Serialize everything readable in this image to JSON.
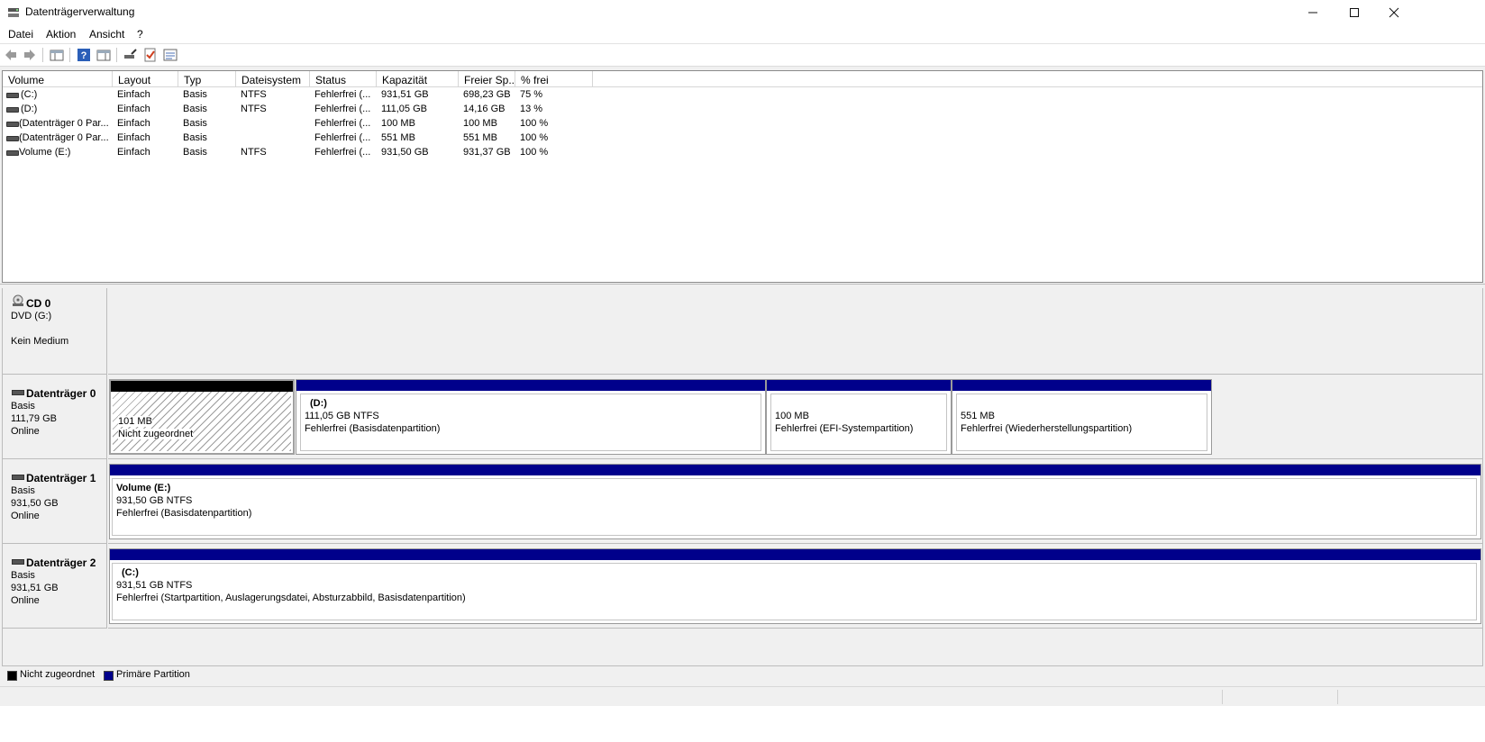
{
  "window": {
    "title": "Datenträgerverwaltung",
    "controls": [
      "minimize",
      "maximize",
      "close"
    ]
  },
  "menu": [
    "Datei",
    "Aktion",
    "Ansicht",
    "?"
  ],
  "toolbar": {
    "icons": [
      "back-arrow-icon",
      "forward-arrow-icon",
      "console-tree-icon",
      "help-icon",
      "action-pane-icon",
      "connect-disk-icon",
      "check-disk-icon",
      "properties-icon"
    ]
  },
  "volume_list": {
    "columns": [
      "Volume",
      "Layout",
      "Typ",
      "Dateisystem",
      "Status",
      "Kapazität",
      "Freier Sp...",
      "% frei"
    ],
    "rows": [
      [
        "(C:)",
        "Einfach",
        "Basis",
        "NTFS",
        "Fehlerfrei (...",
        "931,51 GB",
        "698,23 GB",
        "75 %"
      ],
      [
        "(D:)",
        "Einfach",
        "Basis",
        "NTFS",
        "Fehlerfrei (...",
        "111,05 GB",
        "14,16 GB",
        "13 %"
      ],
      [
        "(Datenträger 0 Par...",
        "Einfach",
        "Basis",
        "",
        "Fehlerfrei (...",
        "100 MB",
        "100 MB",
        "100 %"
      ],
      [
        "(Datenträger 0 Par...",
        "Einfach",
        "Basis",
        "",
        "Fehlerfrei (...",
        "551 MB",
        "551 MB",
        "100 %"
      ],
      [
        "Volume (E:)",
        "Einfach",
        "Basis",
        "NTFS",
        "Fehlerfrei (...",
        "931,50 GB",
        "931,37 GB",
        "100 %"
      ]
    ]
  },
  "disks": {
    "cd0": {
      "name": "CD 0",
      "line1": "DVD (G:)",
      "line2": "Kein Medium"
    },
    "disk0": {
      "name": "Datenträger 0",
      "type": "Basis",
      "size": "111,79 GB",
      "state": "Online",
      "partitions": [
        {
          "title": "",
          "size": "101 MB",
          "status": "Nicht zugeordnet"
        },
        {
          "title": "(D:)",
          "size": "111,05 GB NTFS",
          "status": "Fehlerfrei (Basisdatenpartition)"
        },
        {
          "title": "",
          "size": "100 MB",
          "status": "Fehlerfrei (EFI-Systempartition)"
        },
        {
          "title": "",
          "size": "551 MB",
          "status": "Fehlerfrei (Wiederherstellungspartition)"
        }
      ]
    },
    "disk1": {
      "name": "Datenträger 1",
      "type": "Basis",
      "size": "931,50 GB",
      "state": "Online",
      "partition": {
        "title": "Volume  (E:)",
        "size": "931,50 GB NTFS",
        "status": "Fehlerfrei (Basisdatenpartition)"
      }
    },
    "disk2": {
      "name": "Datenträger 2",
      "type": "Basis",
      "size": "931,51 GB",
      "state": "Online",
      "partition": {
        "title": "(C:)",
        "size": "931,51 GB NTFS",
        "status": "Fehlerfrei (Startpartition, Auslagerungsdatei, Absturzabbild, Basisdatenpartition)"
      }
    }
  },
  "legend": [
    {
      "label": "Nicht zugeordnet",
      "color": "#000000"
    },
    {
      "label": "Primäre Partition",
      "color": "#00008b"
    }
  ],
  "colors": {
    "primary_partition": "#00008b",
    "unallocated": "#000000"
  }
}
